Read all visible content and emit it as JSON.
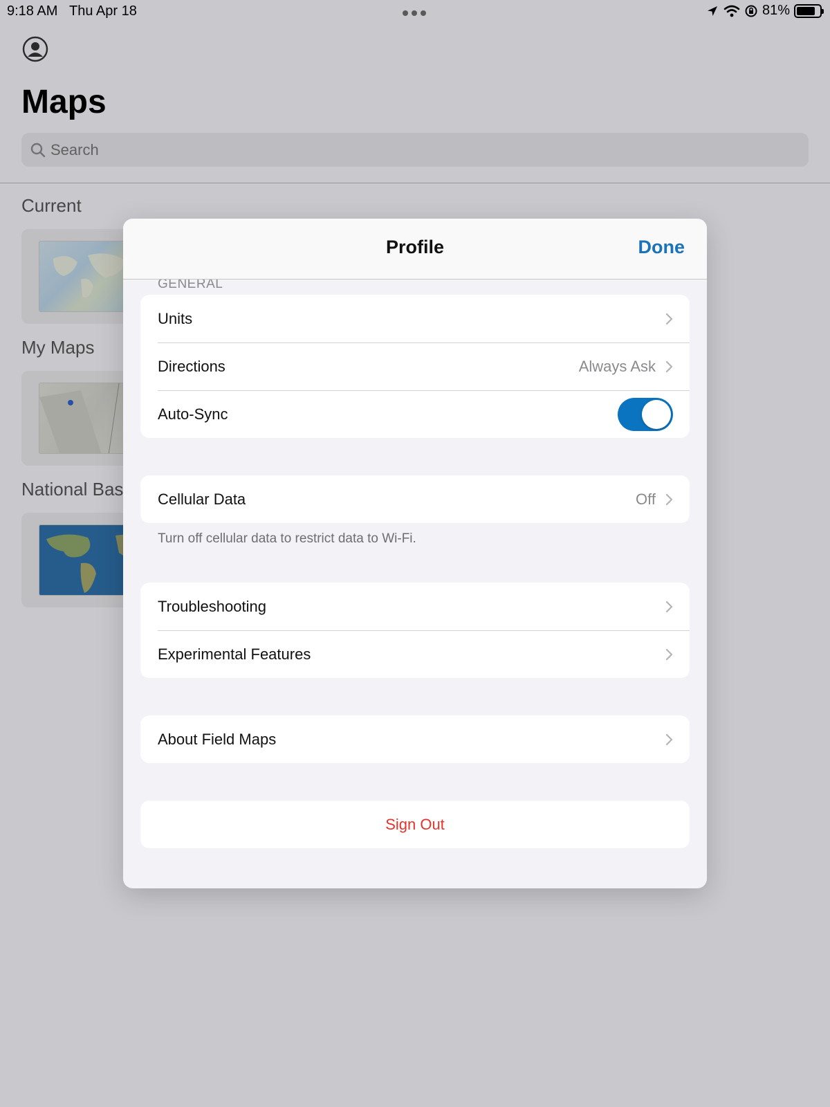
{
  "status_bar": {
    "time": "9:18 AM",
    "date": "Thu Apr 18",
    "battery_percent": "81%",
    "battery_level": 0.81
  },
  "background": {
    "title": "Maps",
    "search_placeholder": "Search",
    "sections": [
      {
        "label": "Current"
      },
      {
        "label": "My Maps"
      },
      {
        "label": "National Bas"
      }
    ]
  },
  "modal": {
    "title": "Profile",
    "done_label": "Done",
    "section_label": "GENERAL",
    "general_rows": [
      {
        "label": "Units",
        "value": ""
      },
      {
        "label": "Directions",
        "value": "Always Ask"
      },
      {
        "label": "Auto-Sync",
        "toggle_on": true
      }
    ],
    "cellular": {
      "label": "Cellular Data",
      "value": "Off"
    },
    "cellular_footnote": "Turn off cellular data to restrict data to Wi-Fi.",
    "support_rows": [
      {
        "label": "Troubleshooting"
      },
      {
        "label": "Experimental Features"
      }
    ],
    "about": {
      "label": "About Field Maps"
    },
    "sign_out": {
      "label": "Sign Out"
    }
  },
  "colors": {
    "accent": "#1a73b8",
    "toggle_on": "#0a74c0",
    "destructive": "#e3342c"
  },
  "icons": [
    "profile-icon",
    "search-icon",
    "location-arrow-icon",
    "wifi-icon",
    "rotation-lock-icon",
    "battery-icon",
    "chevron-right-icon"
  ]
}
